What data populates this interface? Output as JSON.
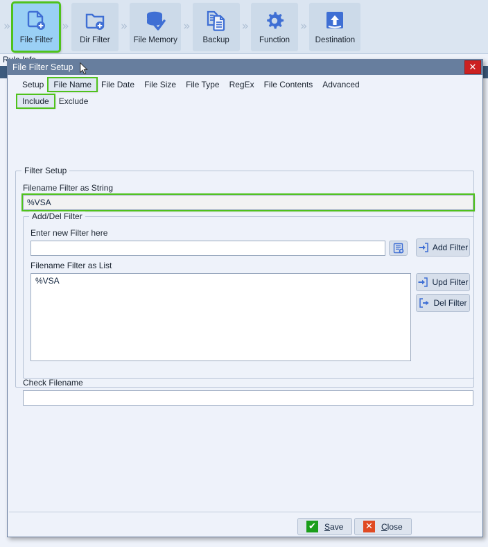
{
  "background": {
    "wizard_steps": [
      {
        "label": "File Filter",
        "icon": "file-add-icon",
        "selected": true
      },
      {
        "label": "Dir Filter",
        "icon": "folder-add-icon",
        "selected": false
      },
      {
        "label": "File Memory",
        "icon": "database-check-icon",
        "selected": false
      },
      {
        "label": "Backup",
        "icon": "copy-documents-icon",
        "selected": false
      },
      {
        "label": "Function",
        "icon": "gear-icon",
        "selected": false
      },
      {
        "label": "Destination",
        "icon": "upload-arrow-icon",
        "selected": false
      }
    ],
    "rule_info_label": "Rule Info"
  },
  "dialog": {
    "title": "File Filter Setup",
    "close_label": "✕",
    "primary_tabs": [
      {
        "label": "Setup",
        "active": false
      },
      {
        "label": "File Name",
        "active": true
      },
      {
        "label": "File Date",
        "active": false
      },
      {
        "label": "File Size",
        "active": false
      },
      {
        "label": "File Type",
        "active": false
      },
      {
        "label": "RegEx",
        "active": false
      },
      {
        "label": "File Contents",
        "active": false
      },
      {
        "label": "Advanced",
        "active": false
      }
    ],
    "secondary_tabs": [
      {
        "label": "Include",
        "active": true
      },
      {
        "label": "Exclude",
        "active": false
      }
    ],
    "filter_setup": {
      "legend": "Filter Setup",
      "filename_filter_string_label": "Filename Filter as String",
      "filename_filter_string_value": "%VSA",
      "filename_filter_string_placeholder": "",
      "add_del_group": {
        "legend": "Add/Del Filter",
        "enter_new_filter_label": "Enter new Filter here",
        "enter_new_filter_value": "",
        "enter_new_filter_placeholder": "",
        "browse_button_icon": "list-add-icon",
        "add_filter_label": "Add Filter",
        "add_filter_icon": "arrow-into-box-icon",
        "filename_filter_list_label": "Filename Filter as List",
        "filter_list_items": [
          "%VSA"
        ],
        "upd_filter_label": "Upd Filter",
        "upd_filter_icon": "arrow-into-box-icon",
        "del_filter_label": "Del Filter",
        "del_filter_icon": "arrow-out-of-box-icon"
      },
      "check_filename_label": "Check Filename",
      "check_filename_value": "",
      "check_filename_placeholder": ""
    },
    "footer": {
      "save_label_pre": "",
      "save_accel": "S",
      "save_label_post": "ave",
      "save_icon": "checkmark-icon",
      "save_icon_glyph": "✔",
      "close_label_pre": "",
      "close_accel": "C",
      "close_label_post": "lose",
      "close_icon": "cross-icon",
      "close_icon_glyph": "✕"
    }
  },
  "colors": {
    "accent_blue": "#3f6fd4",
    "highlight_green": "#4fc21c",
    "titlebar": "#677e9e",
    "dialog_bg": "#eef2fa",
    "save_green": "#1a9e1a",
    "close_red": "#e04a22"
  }
}
